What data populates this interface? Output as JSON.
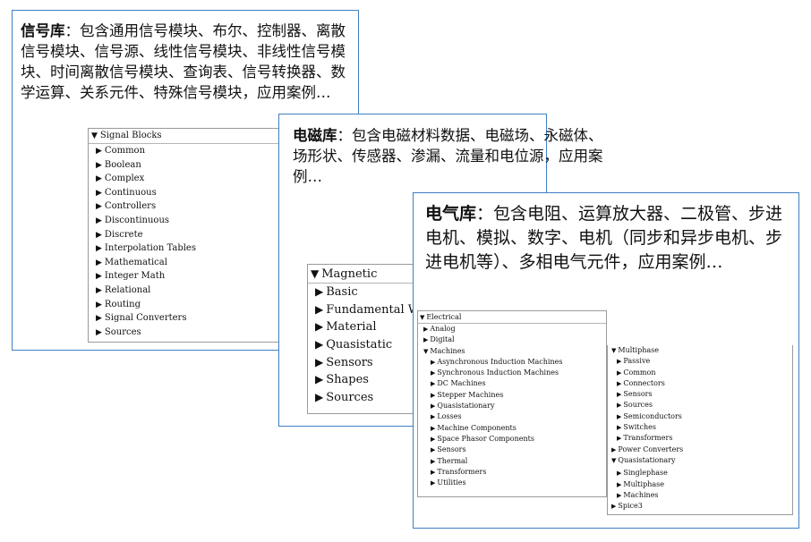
{
  "signal_card": {
    "title": "信号库",
    "description": "：包含通用信号模块、布尔、控制器、离散信号模块、信号源、线性信号模块、非线性信号模块、时间离散信号模块、查询表、信号转换器、数学运算、关系元件、特殊信号模块，应用案例…",
    "tree": {
      "header": "Signal Blocks",
      "items": [
        "Common",
        "Boolean",
        "Complex",
        "Continuous",
        "Controllers",
        "Discontinuous",
        "Discrete",
        "Interpolation Tables",
        "Mathematical",
        "Integer Math",
        "Relational",
        "Routing",
        "Signal Converters",
        "Sources"
      ]
    }
  },
  "magnetic_card": {
    "title": "电磁库",
    "description": "：包含电磁材料数据、电磁场、永磁体、场形状、传感器、渗漏、流量和电位源，应用案例…",
    "tree": {
      "header": "Magnetic",
      "items": [
        "Basic",
        "Fundamental Wa",
        "Material",
        "Quasistatic",
        "Sensors",
        "Shapes",
        "Sources"
      ]
    }
  },
  "electrical_card": {
    "title": "电气库",
    "description": "：包含电阻、运算放大器、二极管、步进电机、模拟、数字、电机（同步和异步电机、步进电机等）、多相电气元件，应用案例…",
    "tree_left": {
      "header": "Electrical",
      "items": [
        {
          "label": "Analog",
          "level": 0
        },
        {
          "label": "Digital",
          "level": 0
        },
        {
          "label": "Machines",
          "level": 0,
          "expanded": true
        },
        {
          "label": "Asynchronous Induction Machines",
          "level": 1
        },
        {
          "label": "Synchronous Induction Machines",
          "level": 1
        },
        {
          "label": "DC Machines",
          "level": 1
        },
        {
          "label": "Stepper Machines",
          "level": 1
        },
        {
          "label": "Quasistationary",
          "level": 1
        },
        {
          "label": "Losses",
          "level": 1
        },
        {
          "label": "Machine Components",
          "level": 1
        },
        {
          "label": "Space Phasor Components",
          "level": 1
        },
        {
          "label": "Sensors",
          "level": 1
        },
        {
          "label": "Thermal",
          "level": 1
        },
        {
          "label": "Transformers",
          "level": 1
        },
        {
          "label": "Utilities",
          "level": 1
        }
      ]
    },
    "tree_right": {
      "items": [
        {
          "label": "Multiphase",
          "level": 0,
          "expanded": true
        },
        {
          "label": "Passive",
          "level": 1
        },
        {
          "label": "Common",
          "level": 1
        },
        {
          "label": "Connectors",
          "level": 1
        },
        {
          "label": "Sensors",
          "level": 1
        },
        {
          "label": "Sources",
          "level": 1
        },
        {
          "label": "Semiconductors",
          "level": 1
        },
        {
          "label": "Switches",
          "level": 1
        },
        {
          "label": "Transformers",
          "level": 1
        },
        {
          "label": "Power Converters",
          "level": 0
        },
        {
          "label": "Quasistationary",
          "level": 0,
          "expanded": true
        },
        {
          "label": "Singlephase",
          "level": 1
        },
        {
          "label": "Multiphase",
          "level": 1
        },
        {
          "label": "Machines",
          "level": 1
        },
        {
          "label": "Spice3",
          "level": 0
        }
      ]
    }
  },
  "icons": {
    "collapsed": "triangle-right-icon",
    "expanded": "triangle-down-icon"
  },
  "colors": {
    "card_border": "#3f7fc4",
    "tree_border": "#9a9a9a"
  }
}
